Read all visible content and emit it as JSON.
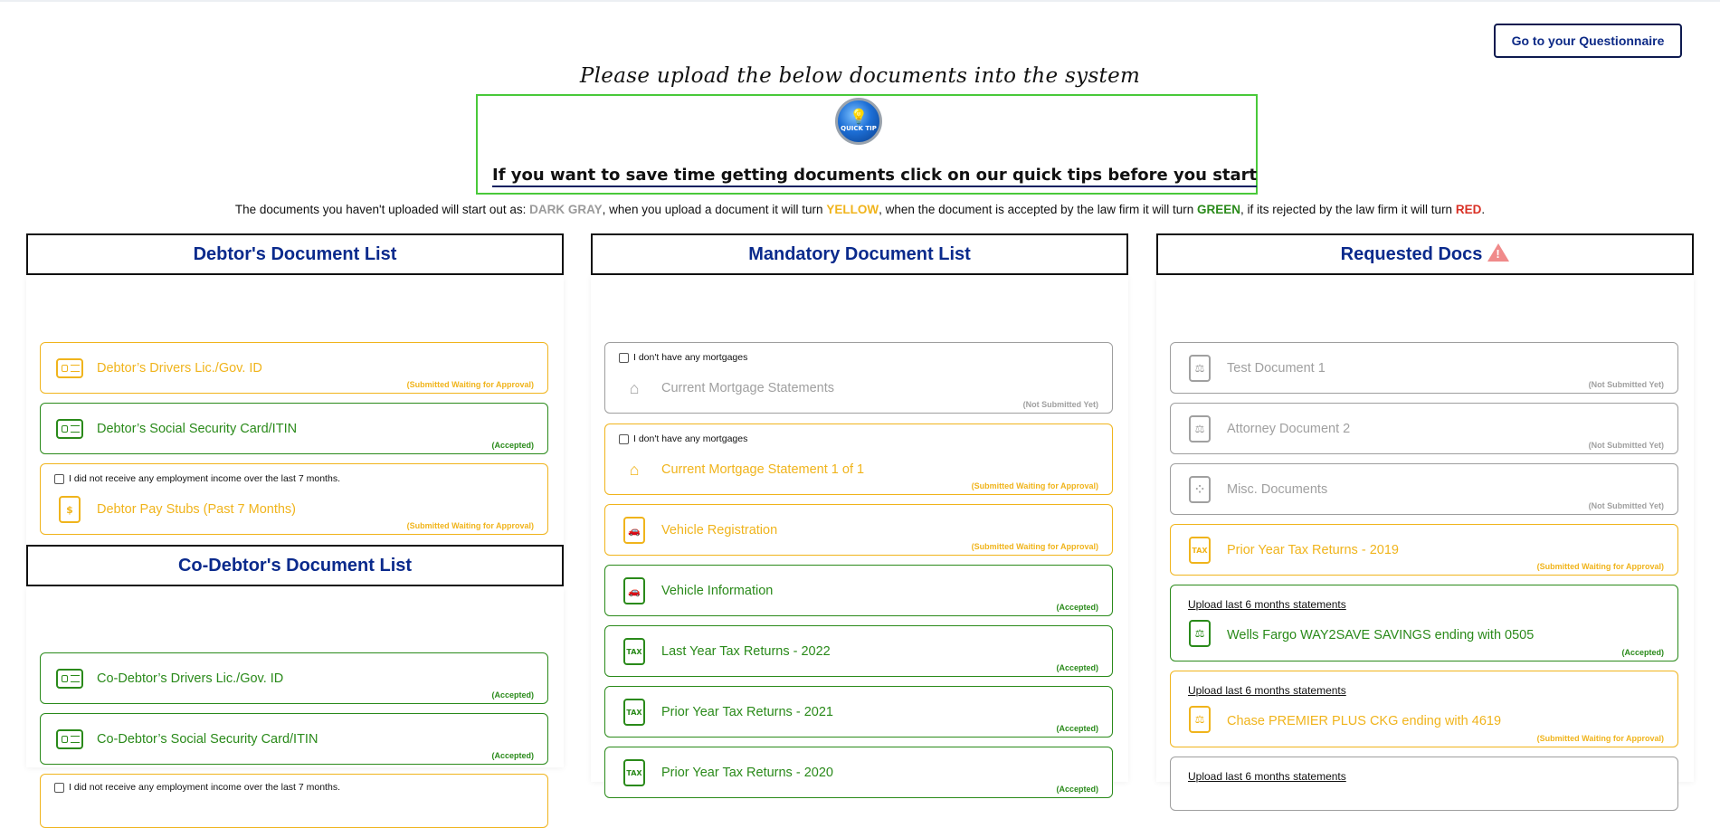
{
  "header": {
    "questionnaire_button": "Go to your Questionnaire",
    "headline": "Please upload the below documents into the system"
  },
  "quick_tip": {
    "badge": "QUICK TIP",
    "text": "If you want to save time getting documents click on our quick tips before you start"
  },
  "legend": {
    "part1": "The documents you haven't uploaded will start out as: ",
    "gray": "DARK GRAY",
    "part2": ", when you upload a document it will turn ",
    "yellow": "YELLOW",
    "part3": ", when the document is accepted by the law firm it will turn ",
    "green": "GREEN",
    "part4": ", if its rejected by the law firm it will turn ",
    "red": "RED",
    "part5": "."
  },
  "status_colors": {
    "not_submitted": "#9e9e9e",
    "waiting": "#f0b41c",
    "accepted": "#2a8a1a",
    "rejected": "#d93025"
  },
  "debtor": {
    "title": "Debtor's Document List",
    "items": [
      {
        "title": "Debtor’s Drivers Lic./Gov. ID",
        "status": "(Submitted Waiting for Approval)",
        "icon": "id-card-icon"
      },
      {
        "title": "Debtor’s Social Security Card/ITIN",
        "status": "(Accepted)",
        "icon": "id-card-icon"
      },
      {
        "checkbox": "I did not receive any employment income over the last 7 months.",
        "title": "Debtor Pay Stubs (Past 7 Months)",
        "status": "(Submitted Waiting for Approval)",
        "icon": "money-document-icon"
      }
    ]
  },
  "codebtor": {
    "title": "Co-Debtor's Document List",
    "items": [
      {
        "title": "Co-Debtor’s Drivers Lic./Gov. ID",
        "status": "(Accepted)",
        "icon": "id-card-icon"
      },
      {
        "title": "Co-Debtor’s Social Security Card/ITIN",
        "status": "(Accepted)",
        "icon": "id-card-icon"
      },
      {
        "checkbox": "I did not receive any employment income over the last 7 months."
      }
    ]
  },
  "mandatory": {
    "title": "Mandatory Document List",
    "items": [
      {
        "checkbox": "I don't have any mortgages",
        "title": "Current Mortgage Statements",
        "status": "(Not Submitted Yet)",
        "icon": "house-dollar-icon"
      },
      {
        "checkbox": "I don't have any mortgages",
        "title": "Current Mortgage Statement 1 of 1",
        "status": "(Submitted Waiting for Approval)",
        "icon": "house-dollar-icon"
      },
      {
        "title": "Vehicle Registration",
        "status": "(Submitted Waiting for Approval)",
        "icon": "car-document-icon"
      },
      {
        "title": "Vehicle Information",
        "status": "(Accepted)",
        "icon": "car-document-icon"
      },
      {
        "title": "Last Year Tax Returns - 2022",
        "status": "(Accepted)",
        "icon": "tax-document-icon",
        "badge": "TAX"
      },
      {
        "title": "Prior Year Tax Returns - 2021",
        "status": "(Accepted)",
        "icon": "tax-document-icon",
        "badge": "TAX"
      },
      {
        "title": "Prior Year Tax Returns - 2020",
        "status": "(Accepted)",
        "icon": "tax-document-icon",
        "badge": "TAX"
      }
    ]
  },
  "requested": {
    "title": "Requested Docs",
    "warning_glyph": "!",
    "items": [
      {
        "title": "Test Document 1",
        "status": "(Not Submitted Yet)",
        "icon": "gavel-document-icon"
      },
      {
        "title": "Attorney Document 2",
        "status": "(Not Submitted Yet)",
        "icon": "gavel-document-icon"
      },
      {
        "title": "Misc. Documents",
        "status": "(Not Submitted Yet)",
        "icon": "misc-document-icon"
      },
      {
        "title": "Prior Year Tax Returns - 2019",
        "status": "(Submitted Waiting for Approval)",
        "icon": "tax-document-icon",
        "badge": "TAX"
      },
      {
        "subheading": "Upload last 6 months statements",
        "title": "Wells Fargo WAY2SAVE SAVINGS ending with 0505",
        "status": "(Accepted)",
        "icon": "gavel-document-icon"
      },
      {
        "subheading": "Upload last 6 months statements",
        "title": "Chase PREMIER PLUS CKG ending with 4619",
        "status": "(Submitted Waiting for Approval)",
        "icon": "gavel-document-icon"
      },
      {
        "subheading": "Upload last 6 months statements"
      }
    ]
  }
}
